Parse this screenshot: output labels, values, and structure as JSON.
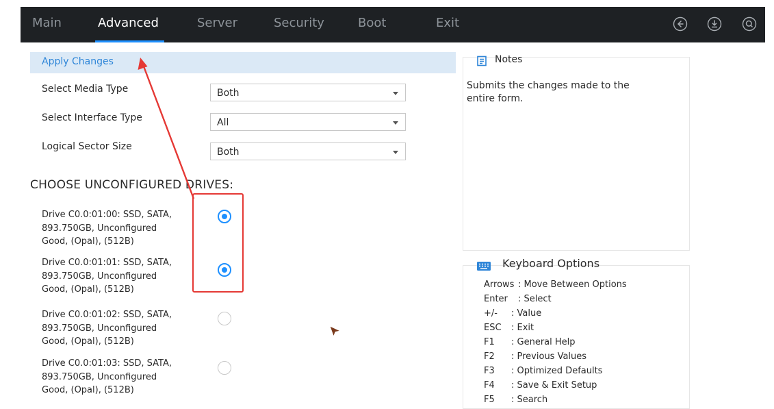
{
  "tabs": [
    {
      "label": "Main",
      "active": false
    },
    {
      "label": "Advanced",
      "active": true
    },
    {
      "label": "Server",
      "active": false
    },
    {
      "label": "Security",
      "active": false
    },
    {
      "label": "Boot",
      "active": false
    },
    {
      "label": "Exit",
      "active": false
    }
  ],
  "topbar_icons": [
    "back-circle-icon",
    "download-circle-icon",
    "search-circle-icon"
  ],
  "form": {
    "apply_label": "Apply Changes",
    "fields": [
      {
        "label": "Select Media Type",
        "value": "Both"
      },
      {
        "label": "Select Interface Type",
        "value": "All"
      },
      {
        "label": "Logical Sector Size",
        "value": "Both"
      }
    ],
    "section_title": "CHOOSE UNCONFIGURED DRIVES:",
    "drives": [
      {
        "line1": "Drive C0.0:01:00: SSD, SATA,",
        "line2": "893.750GB, Unconfigured",
        "line3": "Good, (Opal), (512B)",
        "selected": true
      },
      {
        "line1": "Drive C0.0:01:01: SSD, SATA,",
        "line2": "893.750GB, Unconfigured",
        "line3": "Good, (Opal), (512B)",
        "selected": true
      },
      {
        "line1": "Drive C0.0:01:02: SSD, SATA,",
        "line2": "893.750GB, Unconfigured",
        "line3": "Good, (Opal), (512B)",
        "selected": false
      },
      {
        "line1": "Drive C0.0:01:03: SSD, SATA,",
        "line2": "893.750GB, Unconfigured",
        "line3": "Good, (Opal), (512B)",
        "selected": false
      }
    ]
  },
  "notes": {
    "title": "Notes",
    "line1": "Submits the changes made to the",
    "line2": "entire form."
  },
  "keyboard": {
    "title": "Keyboard Options",
    "rows": [
      {
        "key": "Arrows",
        "desc": ": Move Between Options"
      },
      {
        "key": "Enter",
        "desc": ": Select"
      },
      {
        "key": "+/-",
        "desc": ": Value"
      },
      {
        "key": "ESC",
        "desc": ": Exit"
      },
      {
        "key": "F1",
        "desc": ": General Help"
      },
      {
        "key": "F2",
        "desc": ": Previous Values"
      },
      {
        "key": "F3",
        "desc": ": Optimized Defaults"
      },
      {
        "key": "F4",
        "desc": ": Save & Exit Setup"
      },
      {
        "key": "F5",
        "desc": ": Search"
      }
    ]
  },
  "colors": {
    "topbar": "#1e2124",
    "accent": "#1e90ff",
    "apply_row_bg": "#dbe9f6",
    "annotation_red": "#e53935"
  }
}
